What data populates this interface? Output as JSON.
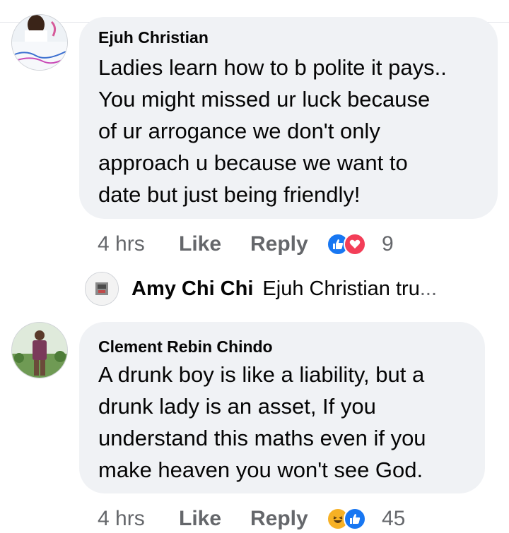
{
  "comments": [
    {
      "author": "Ejuh Christian",
      "lines": [
        "Ladies learn how to b polite it pays..",
        "You might missed ur luck because",
        "of ur arrogance we don't only",
        "approach u because we want to",
        "date but just being friendly!"
      ],
      "time": "4 hrs",
      "like_label": "Like",
      "reply_label": "Reply",
      "reactions": [
        "like-icon",
        "love-icon"
      ],
      "reaction_count": "9"
    },
    {
      "author": "Clement Rebin Chindo",
      "lines": [
        "A drunk  boy is like a liability, but a",
        "drunk lady is an asset, If you",
        "understand this maths even if  you",
        "make heaven you won't see God."
      ],
      "time": "4 hrs",
      "like_label": "Like",
      "reply_label": "Reply",
      "reactions": [
        "haha-icon",
        "like-icon"
      ],
      "reaction_count": "45"
    }
  ],
  "reply_preview": {
    "author": "Amy Chi Chi",
    "snippet": "Ejuh Christian tru",
    "ellipsis": "..."
  },
  "colors": {
    "bubble": "#f0f2f5",
    "meta_text": "#65676b",
    "like_blue": "#1877f2",
    "love_red": "#f33e58",
    "haha_yellow": "#f7b125"
  }
}
